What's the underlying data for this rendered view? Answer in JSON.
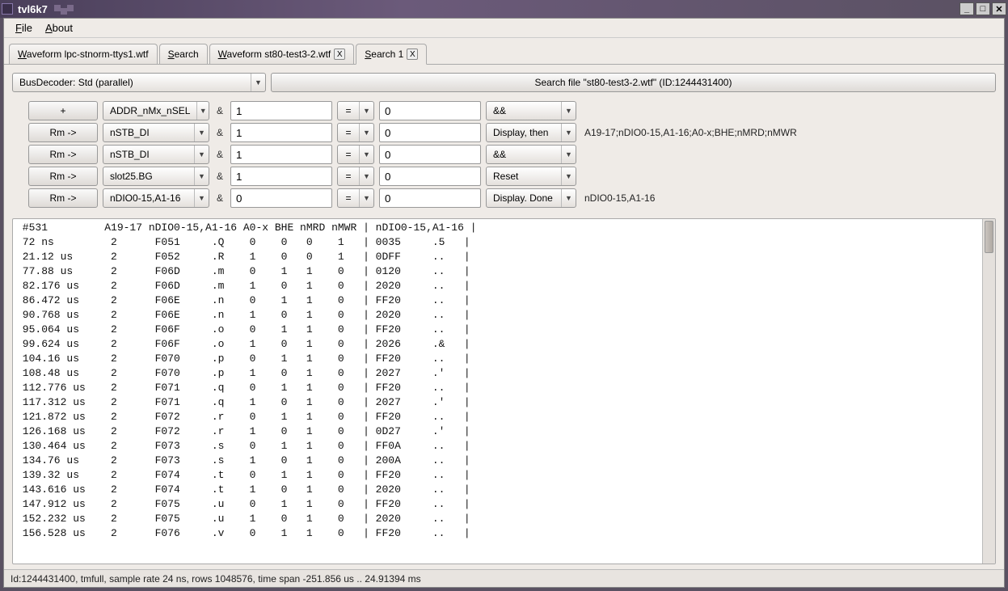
{
  "window": {
    "title": "tvl6k7"
  },
  "menu": {
    "file": "File",
    "about": "About"
  },
  "tabs": [
    {
      "label": "Waveform lpc-stnorm-ttys1.wtf",
      "closable": false
    },
    {
      "label": "Search",
      "closable": false
    },
    {
      "label": "Waveform st80-test3-2.wtf",
      "closable": true
    },
    {
      "label": "Search 1",
      "closable": true
    }
  ],
  "active_tab": 3,
  "decoder": "BusDecoder: Std (parallel)",
  "search_button": "Search file \"st80-test3-2.wtf\" (ID:1244431400)",
  "rows": [
    {
      "btn": "+",
      "signal": "ADDR_nMx_nSEL",
      "amp": "&",
      "v1": "1",
      "op": "=",
      "v2": "0",
      "action": "&&",
      "trail": ""
    },
    {
      "btn": "Rm ->",
      "signal": "nSTB_DI",
      "amp": "&",
      "v1": "1",
      "op": "=",
      "v2": "0",
      "action": "Display, then",
      "trail": "A19-17;nDIO0-15,A1-16;A0-x;BHE;nMRD;nMWR"
    },
    {
      "btn": "Rm ->",
      "signal": "nSTB_DI",
      "amp": "&",
      "v1": "1",
      "op": "=",
      "v2": "0",
      "action": "&&",
      "trail": ""
    },
    {
      "btn": "Rm ->",
      "signal": "slot25.BG",
      "amp": "&",
      "v1": "1",
      "op": "=",
      "v2": "0",
      "action": "Reset",
      "trail": ""
    },
    {
      "btn": "Rm ->",
      "signal": "nDIO0-15,A1-16",
      "amp": "&",
      "v1": "0",
      "op": "=",
      "v2": "0",
      "action": "Display. Done",
      "trail": "nDIO0-15,A1-16"
    }
  ],
  "results_header": " #531         A19-17 nDIO0-15,A1-16 A0-x BHE nMRD nMWR | nDIO0-15,A1-16 |",
  "results": [
    " 72 ns         2      F051     .Q    0    0   0    1   | 0035     .5   |",
    " 21.12 us      2      F052     .R    1    0   0    1   | 0DFF     ..   |",
    " 77.88 us      2      F06D     .m    0    1   1    0   | 0120     ..   |",
    " 82.176 us     2      F06D     .m    1    0   1    0   | 2020     ..   |",
    " 86.472 us     2      F06E     .n    0    1   1    0   | FF20     ..   |",
    " 90.768 us     2      F06E     .n    1    0   1    0   | 2020     ..   |",
    " 95.064 us     2      F06F     .o    0    1   1    0   | FF20     ..   |",
    " 99.624 us     2      F06F     .o    1    0   1    0   | 2026     .&   |",
    " 104.16 us     2      F070     .p    0    1   1    0   | FF20     ..   |",
    " 108.48 us     2      F070     .p    1    0   1    0   | 2027     .'   |",
    " 112.776 us    2      F071     .q    0    1   1    0   | FF20     ..   |",
    " 117.312 us    2      F071     .q    1    0   1    0   | 2027     .'   |",
    " 121.872 us    2      F072     .r    0    1   1    0   | FF20     ..   |",
    " 126.168 us    2      F072     .r    1    0   1    0   | 0D27     .'   |",
    " 130.464 us    2      F073     .s    0    1   1    0   | FF0A     ..   |",
    " 134.76 us     2      F073     .s    1    0   1    0   | 200A     ..   |",
    " 139.32 us     2      F074     .t    0    1   1    0   | FF20     ..   |",
    " 143.616 us    2      F074     .t    1    0   1    0   | 2020     ..   |",
    " 147.912 us    2      F075     .u    0    1   1    0   | FF20     ..   |",
    " 152.232 us    2      F075     .u    1    0   1    0   | 2020     ..   |",
    " 156.528 us    2      F076     .v    0    1   1    0   | FF20     ..   |"
  ],
  "statusbar": "Id:1244431400, tmfull, sample rate 24 ns, rows 1048576, time span -251.856 us .. 24.91394 ms"
}
